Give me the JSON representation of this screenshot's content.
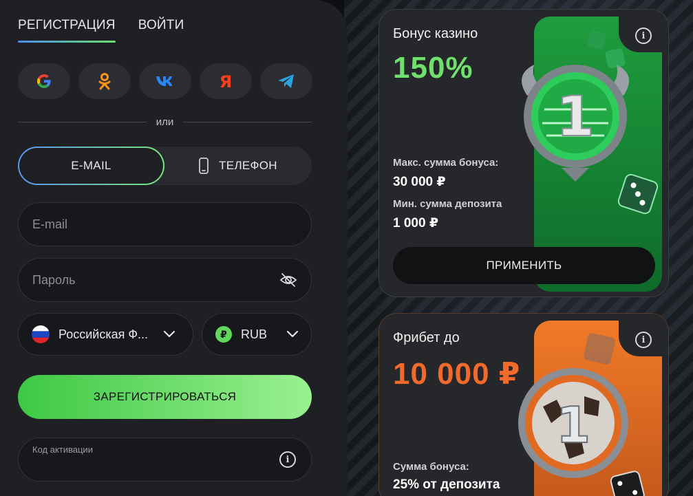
{
  "auth": {
    "tabs": [
      "РЕГИСТРАЦИЯ",
      "ВОЙТИ"
    ],
    "divider_text": "или",
    "methods": {
      "email": "E-MAIL",
      "phone": "ТЕЛЕФОН"
    },
    "email_placeholder": "E-mail",
    "password_placeholder": "Пароль",
    "country": "Российская Ф...",
    "currency": "RUB",
    "register_label": "ЗАРЕГИСТРИРОВАТЬСЯ",
    "promo_label": "Код активации"
  },
  "socials": [
    {
      "name": "google",
      "glyph": "G",
      "color": "#4285f4"
    },
    {
      "name": "odnoklassniki",
      "glyph": "ок",
      "color": "#f7931e"
    },
    {
      "name": "vk",
      "glyph": "vk",
      "color": "#2787f5"
    },
    {
      "name": "yandex",
      "glyph": "Я",
      "color": "#fc3f1d"
    },
    {
      "name": "telegram",
      "glyph": "➤",
      "color": "#2aa3e0"
    }
  ],
  "cards": [
    {
      "title": "Бонус казино",
      "amount": "150%",
      "amount_color": "#6ee06b",
      "label1": "Макс. сумма бонуса:",
      "value1": "30 000 ₽",
      "label2": "Мин. сумма депозита",
      "value2": "1 000 ₽",
      "button": "ПРИМЕНИТЬ",
      "medal_number": "1"
    },
    {
      "title": "Фрибет до",
      "amount": "10 000 ₽",
      "amount_color": "#f26a2b",
      "label1": "Сумма бонуса:",
      "value1": "25% от депозита",
      "medal_number": "1"
    }
  ]
}
